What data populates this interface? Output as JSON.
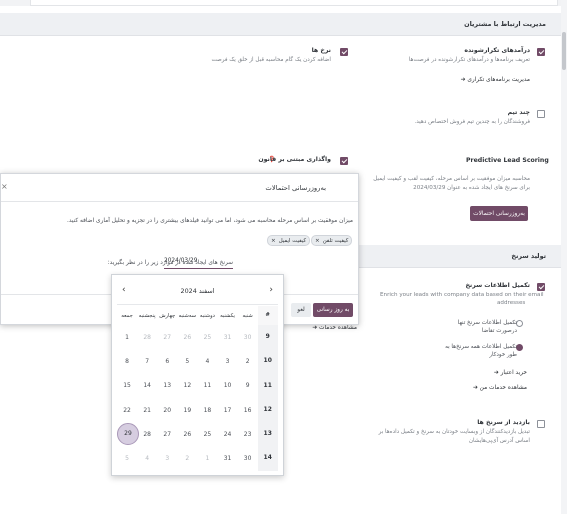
{
  "crm_section": {
    "header": "مدیریت ارتباط با مشتریان",
    "recurring": {
      "title": "درآمدهای تکرارشونده",
      "desc": "تعریف برنامه‌ها و درآمدهای تکرارشونده در فرصت‌ها",
      "link": "مدیریت برنامه‌های تکراری",
      "checked": true
    },
    "rates": {
      "title": "نرخ ها",
      "desc": "اضافه کردن یک گام محاسبه قبل از خلق یک فرصت",
      "checked": true
    },
    "multi_team": {
      "title": "چند تیم",
      "desc": "فروشندگان را به چندین تیم فروش اختصاص دهید.",
      "checked": false
    },
    "assign_rule": {
      "title": "واگذاری مبتنی بر قانون",
      "checked": true
    },
    "pls": {
      "title": "Predictive Lead Scoring",
      "desc1": "محاسبه میزان موفقیت بر اساس مرحله، کیفیت لقب و کیفیت ایمیل",
      "desc2": "برای سرنخ های ایجاد شده به عنوان 2024/03/29",
      "button": "به‌روزرسانی احتمالات"
    }
  },
  "lead_section": {
    "header": "تولید سرنخ",
    "enrich": {
      "title": "تکمیل اطلاعات سرنخ",
      "desc1": "Enrich your leads with company data based on their email",
      "desc2": "addresses",
      "opt1_line1": "تکمیل اطلاعات سرنخ تنها",
      "opt1_line2": "درصورت تقاضا",
      "opt2_line1": "تکمیل اطلاعات همه سرنخ‌ها به",
      "opt2_line2": "طور خودکار",
      "link1": "خرید اعتبار",
      "link2": "مشاهده خدمات من"
    },
    "visits": {
      "title": "بازدید از سرنخ ها",
      "desc1": "تبدیل بازدیدکنندگان از وبسایت خودتان به سرنخ و تکمیل داده‌ها بر",
      "desc2": "اساس آدرس آی‌پی‌هایشان"
    },
    "services_link": "مشاهده خدمات"
  },
  "modal": {
    "title": "به‌روزرسانی احتمالات",
    "close": "×",
    "description": "میزان موفقیت بر اساس مرحله محاسبه می شود، اما می توانید فیلدهای بیشتری را در تجزیه و تحلیل آماری اضافه کنید.",
    "tags": [
      "کیفیت تلفن",
      "کیفیت ایمیل"
    ],
    "tag_remove": "×",
    "date_label": "سرنخ های ایجاد شده در موارد زیر را در نظر بگیرید:",
    "date_value": "2024/03/29",
    "confirm_button": "به روز رسانی",
    "cancel_button": "لغو"
  },
  "calendar": {
    "prev": "‹",
    "next": "›",
    "month_label": "اسفند 2024",
    "headers": [
      "#",
      "شنبه",
      "یکشنبه",
      "دوشنبه",
      "سه‌شنبه",
      "چهارش",
      "پنجشنبه",
      "جمعه"
    ],
    "rows": [
      {
        "week": "9",
        "days": [
          "30",
          "31",
          "25",
          "26",
          "27",
          "28",
          "1"
        ],
        "muted": [
          true,
          true,
          true,
          true,
          true,
          true,
          false
        ]
      },
      {
        "week": "10",
        "days": [
          "2",
          "3",
          "4",
          "5",
          "6",
          "7",
          "8"
        ],
        "muted": [
          false,
          false,
          false,
          false,
          false,
          false,
          false
        ]
      },
      {
        "week": "11",
        "days": [
          "9",
          "10",
          "11",
          "12",
          "13",
          "14",
          "15"
        ],
        "muted": [
          false,
          false,
          false,
          false,
          false,
          false,
          false
        ]
      },
      {
        "week": "12",
        "days": [
          "16",
          "17",
          "18",
          "19",
          "20",
          "21",
          "22"
        ],
        "muted": [
          false,
          false,
          false,
          false,
          false,
          false,
          false
        ]
      },
      {
        "week": "13",
        "days": [
          "23",
          "24",
          "25",
          "26",
          "27",
          "28",
          "29"
        ],
        "muted": [
          false,
          false,
          false,
          false,
          false,
          false,
          false
        ]
      },
      {
        "week": "14",
        "days": [
          "30",
          "31",
          "1",
          "2",
          "3",
          "4",
          "5"
        ],
        "muted": [
          false,
          false,
          true,
          true,
          true,
          true,
          true
        ]
      }
    ],
    "selected_day": "29"
  },
  "colors": {
    "accent": "#714b67",
    "selected_day_bg": "#d6cde0"
  }
}
